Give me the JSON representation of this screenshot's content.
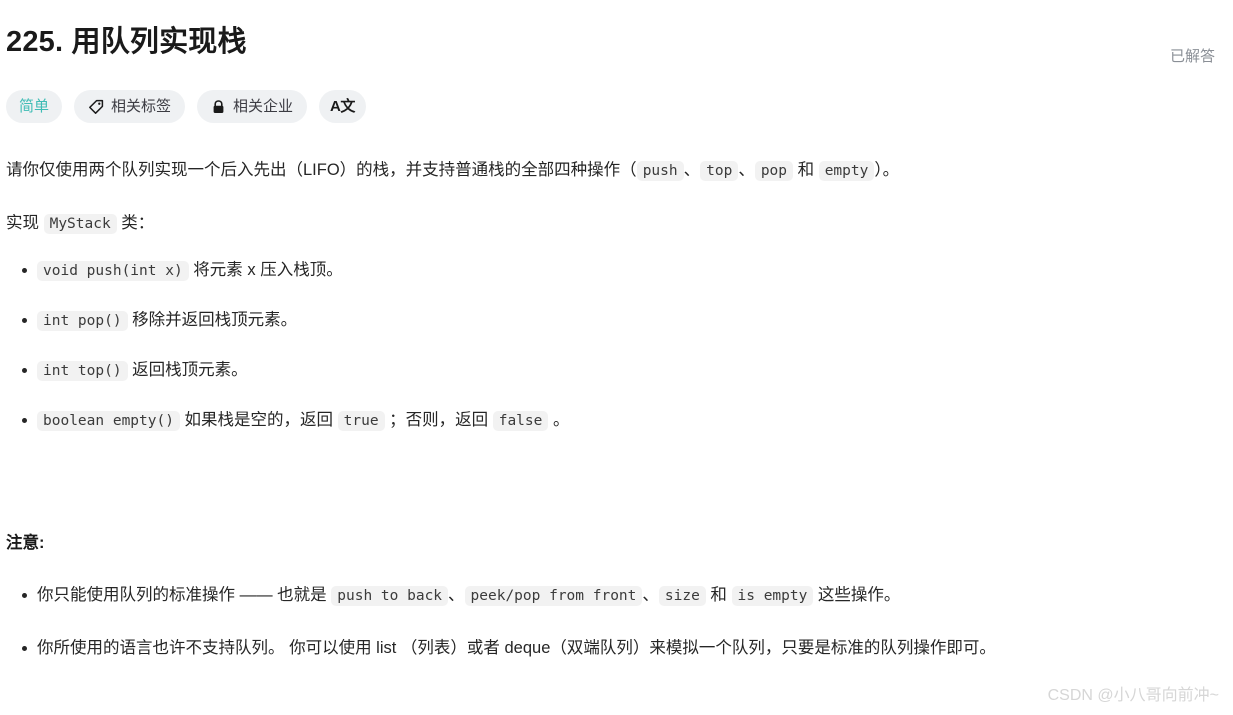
{
  "header": {
    "title": "225. 用队列实现栈",
    "status": "已解答"
  },
  "badges": [
    {
      "label": "简单",
      "icon": "none",
      "kind": "difficulty"
    },
    {
      "label": "相关标签",
      "icon": "tag-icon",
      "kind": "normal"
    },
    {
      "label": "相关企业",
      "icon": "lock-icon",
      "kind": "normal"
    },
    {
      "label": "A文",
      "icon": "translate-icon",
      "kind": "icon-only"
    }
  ],
  "description": {
    "intro": {
      "t1": "请你仅使用两个队列实现一个后入先出（LIFO）的栈，并支持普通栈的全部四种操作（",
      "c1": "push",
      "t2": "、",
      "c2": "top",
      "t3": "、",
      "c3": "pop",
      "t4": " 和 ",
      "c4": "empty",
      "t5": "）。"
    },
    "implement": {
      "t1": "实现 ",
      "c1": "MyStack",
      "t2": " 类："
    },
    "methods": [
      {
        "code": "void push(int x)",
        "text": " 将元素 x 压入栈顶。"
      },
      {
        "code": "int pop()",
        "text": " 移除并返回栈顶元素。"
      },
      {
        "code": "int top()",
        "text": " 返回栈顶元素。"
      }
    ],
    "empty_method": {
      "c1": "boolean empty()",
      "t1": " 如果栈是空的，返回 ",
      "c2": "true",
      "t2": " ；否则，返回 ",
      "c3": "false",
      "t3": " 。"
    }
  },
  "notice": {
    "heading": "注意:",
    "item1": {
      "t1": "你只能使用队列的标准操作 —— 也就是 ",
      "c1": "push to back",
      "t2": "、",
      "c2": "peek/pop from front",
      "t3": "、",
      "c3": "size",
      "t4": " 和 ",
      "c4": "is empty",
      "t5": " 这些操作。"
    },
    "item2": "你所使用的语言也许不支持队列。 你可以使用 list （列表）或者 deque（双端队列）来模拟一个队列，只要是标准的队列操作即可。"
  },
  "watermark": "CSDN @小八哥向前冲~",
  "colors": {
    "difficulty": "#3fbcb5",
    "badge_bg": "#eff1f3",
    "code_bg": "#f2f2f2",
    "text": "#262626",
    "muted": "#8a8f96",
    "watermark": "#d6d6d6"
  }
}
